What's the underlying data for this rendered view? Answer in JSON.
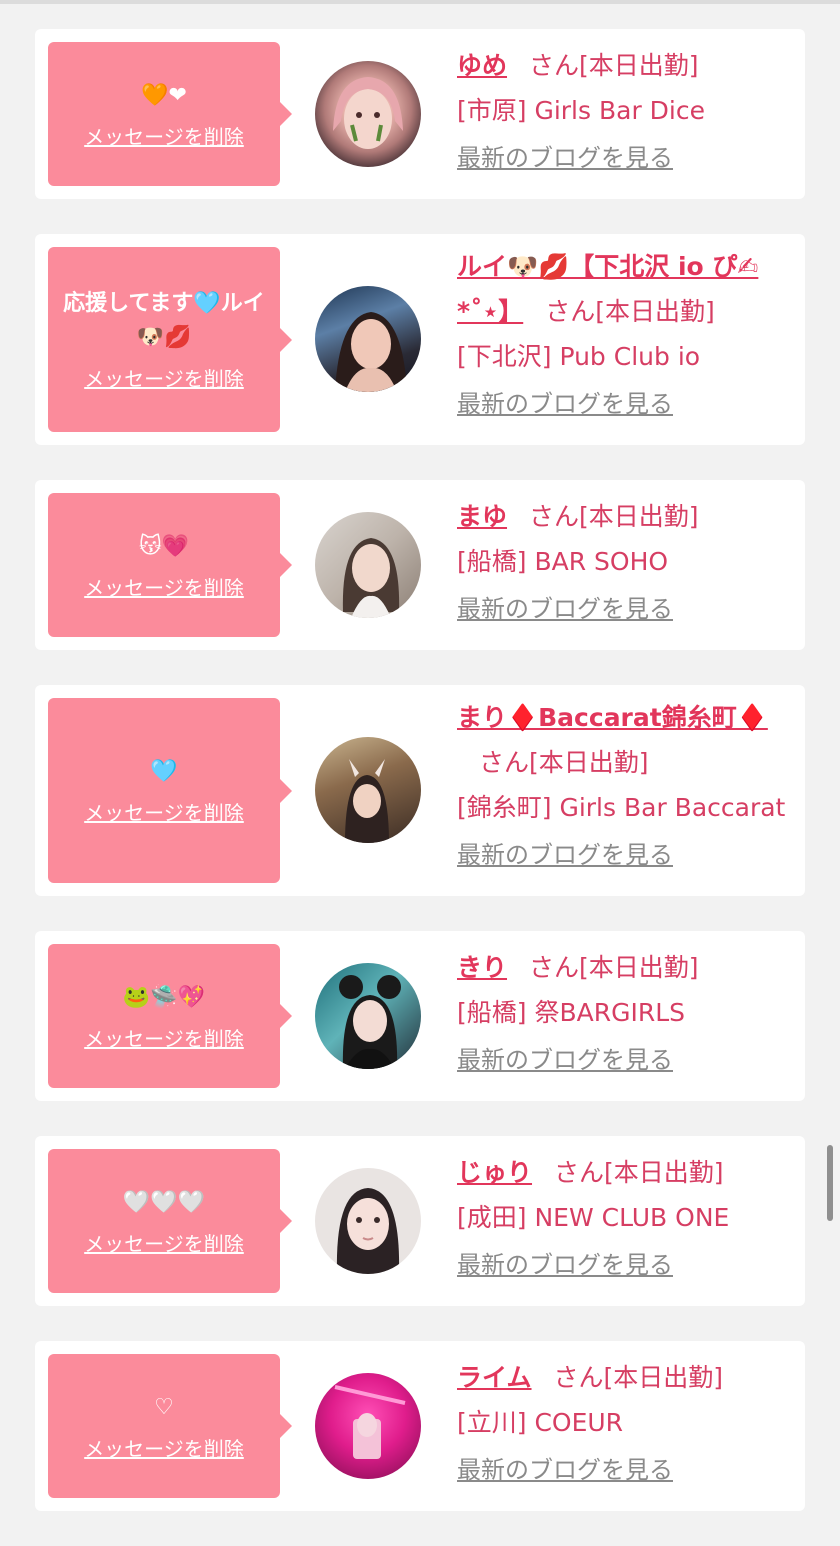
{
  "common": {
    "delete_label": "メッセージを削除",
    "san_label": "さん",
    "attendance_label": "[本日出勤]",
    "blog_label": "最新のブログを見る"
  },
  "colors": {
    "bubble": "#fb8b9b",
    "name": "#e2365b",
    "text": "#d63e63",
    "link_gray": "#8a8a8a",
    "background": "#f2f2f2"
  },
  "entries": [
    {
      "message": "🧡❤",
      "name": "ゆめ",
      "shop": "[市原] Girls Bar Dice"
    },
    {
      "message": "応援してます🩵ルイ🐶💋",
      "name": "ルイ🐶💋【下北沢 io ぴ✍︎*˚⋆】",
      "shop": "[下北沢] Pub Club io"
    },
    {
      "message": "😽💗",
      "name": "まゆ",
      "shop": "[船橋] BAR SOHO"
    },
    {
      "message": "🩵",
      "name": "まり♦️Baccarat錦糸町♦️",
      "shop": "[錦糸町] Girls Bar Baccarat"
    },
    {
      "message": "🐸🛸💖",
      "name": "きり",
      "shop": "[船橋] 祭BARGIRLS"
    },
    {
      "message": "🤍🤍🤍",
      "name": "じゅり",
      "shop": "[成田] NEW CLUB ONE"
    },
    {
      "message": "♡",
      "name": "ライム",
      "shop": "[立川] COEUR"
    }
  ]
}
